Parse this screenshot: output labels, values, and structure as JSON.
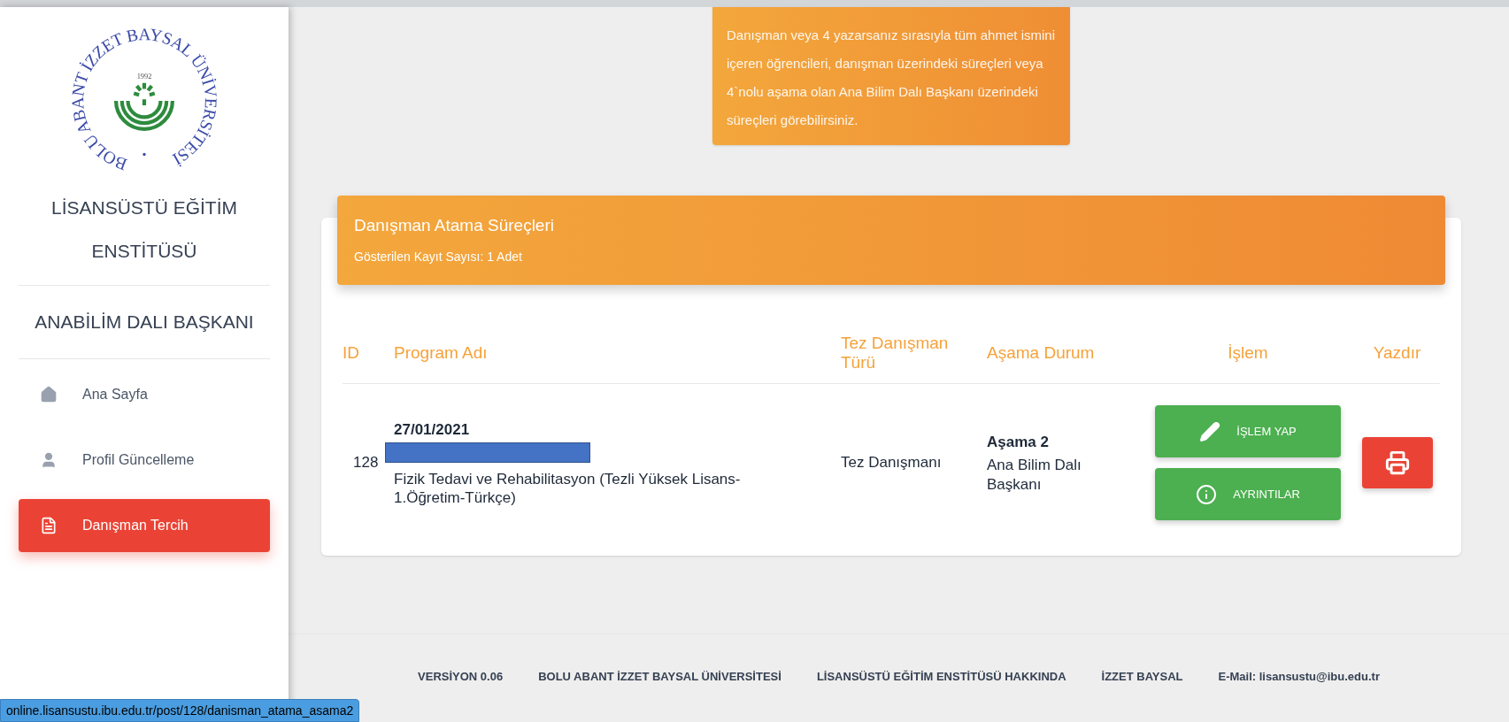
{
  "sidebar": {
    "logo": {
      "ring_text": "BOLU ABANT İZZET BAYSAL ÜNİVERSİTESİ",
      "year": "1992"
    },
    "institute": "LİSANSÜSTÜ EĞİTİM ENSTİTÜSÜ",
    "role": "ANABİLİM DALI BAŞKANI",
    "items": [
      {
        "label": "Ana Sayfa",
        "kind": "home",
        "selected": false
      },
      {
        "label": "Profil Güncelleme",
        "kind": "person",
        "selected": false
      },
      {
        "label": "Danışman Tercih",
        "kind": "document",
        "selected": true
      }
    ]
  },
  "notice": {
    "text": "Danışman veya 4 yazarsanız sırasıyla tüm ahmet ismini içeren öğrencileri, danışman üzerindeki süreçleri veya 4`nolu aşama olan Ana Bilim Dalı Başkanı üzerindeki süreçleri görebilirsiniz."
  },
  "table": {
    "title": "Danışman Atama Süreçleri",
    "subtitle": "Gösterilen Kayıt Sayısı: 1 Adet",
    "columns": [
      "ID",
      "Program Adı",
      "Tez Danışman Türü",
      "Aşama Durum",
      "İşlem",
      "Yazdır"
    ],
    "rows": [
      {
        "id": "128",
        "date": "27/01/2021",
        "program": "Fizik Tedavi ve Rehabilitasyon (Tezli Yüksek Lisans-1.Öğretim-Türkçe)",
        "advisor_type": "Tez Danışmanı",
        "stage": "Aşama 2",
        "stage_status": "Ana Bilim Dalı Başkanı",
        "actions": [
          {
            "label": "İŞLEM YAP",
            "kind": "edit"
          },
          {
            "label": "AYRINTILAR",
            "kind": "info"
          }
        ]
      }
    ]
  },
  "footer": {
    "links": [
      "VERSİYON 0.06",
      "BOLU ABANT İZZET BAYSAL ÜNİVERSİTESİ",
      "LİSANSÜSTÜ EĞİTİM ENSTİTÜSÜ HAKKINDA",
      "İZZET BAYSAL",
      "E-Mail: lisansustu@ibu.edu.tr"
    ]
  },
  "status_url": "online.lisansustu.ibu.edu.tr/post/128/danisman_atama_asama2"
}
